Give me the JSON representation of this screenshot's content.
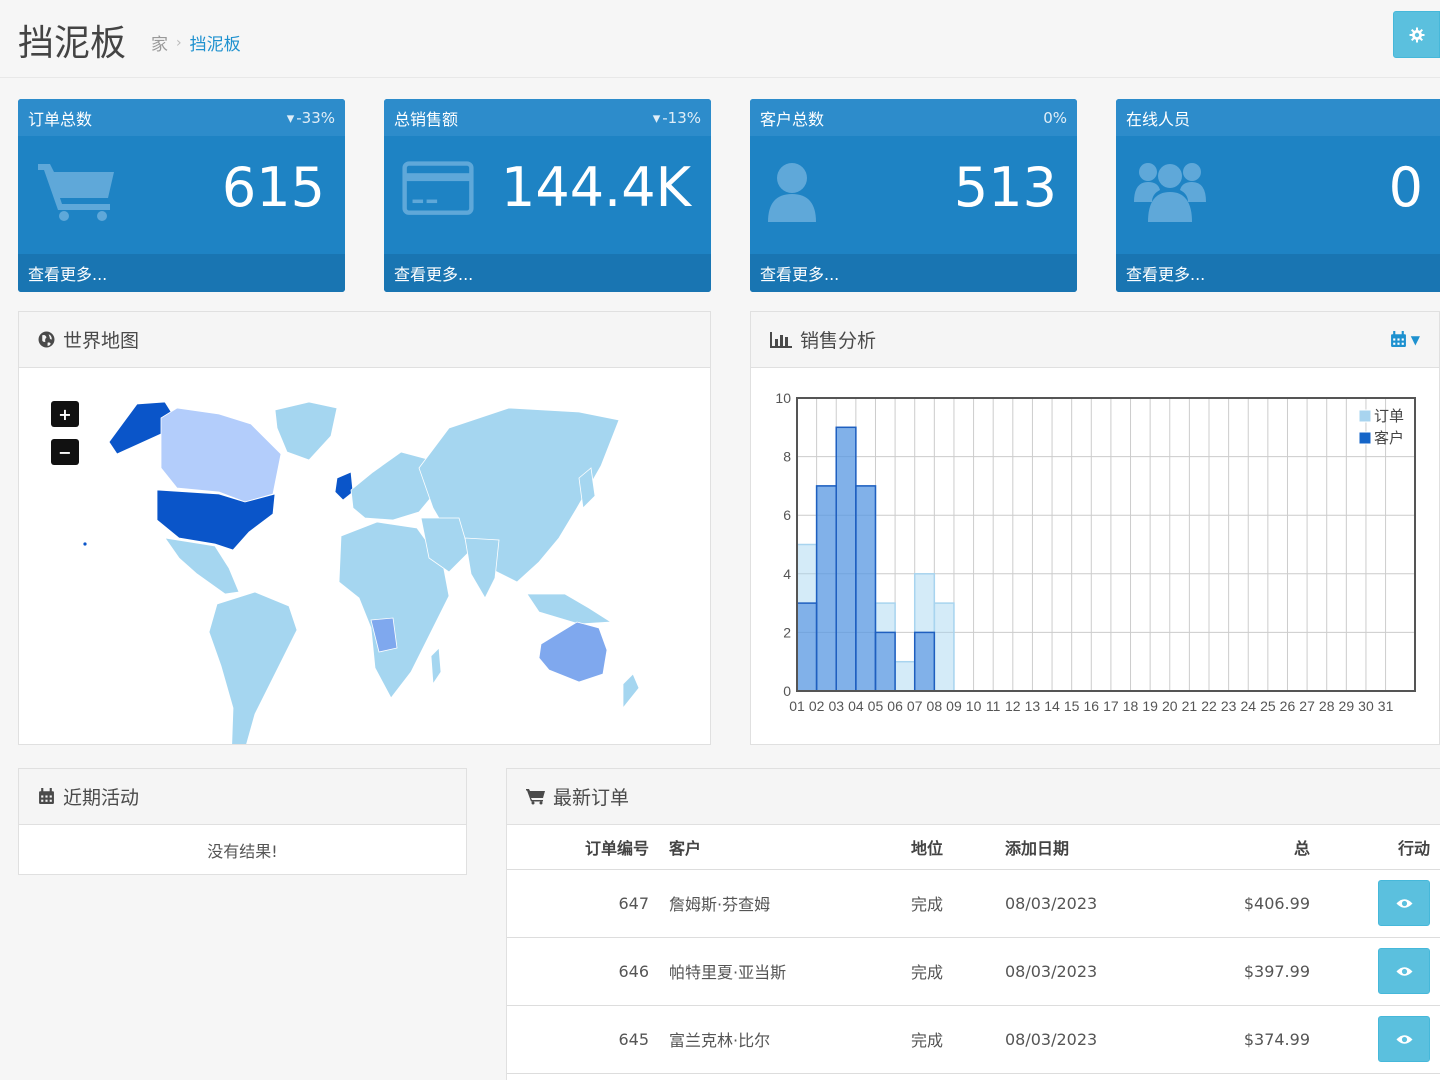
{
  "header": {
    "title": "挡泥板",
    "breadcrumb": [
      "家",
      "挡泥板"
    ]
  },
  "tiles": [
    {
      "title": "订单总数",
      "delta": "-33%",
      "value": "615",
      "more": "查看更多...",
      "icon": "shopping-cart-icon"
    },
    {
      "title": "总销售额",
      "delta": "-13%",
      "value": "144.4K",
      "more": "查看更多...",
      "icon": "credit-card-icon"
    },
    {
      "title": "客户总数",
      "delta": "0%",
      "value": "513",
      "more": "查看更多...",
      "icon": "user-icon"
    },
    {
      "title": "在线人员",
      "value": "0",
      "more": "查看更多...",
      "icon": "users-icon"
    }
  ],
  "map_panel": {
    "title": "世界地图",
    "zoom_in": "+",
    "zoom_out": "−"
  },
  "sales_panel": {
    "title": "销售分析"
  },
  "activity_panel": {
    "title": "近期活动",
    "empty": "没有结果!"
  },
  "orders_panel": {
    "title": "最新订单",
    "columns": [
      "订单编号",
      "客户",
      "地位",
      "添加日期",
      "总",
      "行动"
    ],
    "rows": [
      {
        "id": "647",
        "customer": "詹姆斯·芬查姆",
        "status": "完成",
        "date": "08/03/2023",
        "total": "$406.99"
      },
      {
        "id": "646",
        "customer": "帕特里夏·亚当斯",
        "status": "完成",
        "date": "08/03/2023",
        "total": "$397.99"
      },
      {
        "id": "645",
        "customer": "富兰克林·比尔",
        "status": "完成",
        "date": "08/03/2023",
        "total": "$374.99"
      }
    ]
  },
  "colors": {
    "tile": "#1e83c4",
    "accent": "#1e91cf",
    "info": "#5bc0de",
    "orders": "#cde9f7",
    "customers": "#1565c8"
  },
  "chart_data": {
    "type": "bar",
    "categories": [
      "01",
      "02",
      "03",
      "04",
      "05",
      "06",
      "07",
      "08",
      "09",
      "10",
      "11",
      "12",
      "13",
      "14",
      "15",
      "16",
      "17",
      "18",
      "19",
      "20",
      "21",
      "22",
      "23",
      "24",
      "25",
      "26",
      "27",
      "28",
      "29",
      "30",
      "31"
    ],
    "series": [
      {
        "name": "订单",
        "values": [
          5,
          7,
          9,
          7,
          3,
          1,
          4,
          3,
          0,
          0,
          0,
          0,
          0,
          0,
          0,
          0,
          0,
          0,
          0,
          0,
          0,
          0,
          0,
          0,
          0,
          0,
          0,
          0,
          0,
          0,
          0
        ]
      },
      {
        "name": "客户",
        "values": [
          3,
          7,
          9,
          7,
          2,
          0,
          2,
          0,
          0,
          0,
          0,
          0,
          0,
          0,
          0,
          0,
          0,
          0,
          0,
          0,
          0,
          0,
          0,
          0,
          0,
          0,
          0,
          0,
          0,
          0,
          0
        ]
      }
    ],
    "ylim": [
      0,
      10
    ],
    "yticks": [
      "0",
      "2",
      "4",
      "6",
      "8",
      "10"
    ],
    "legend": "top-right",
    "grid": true
  }
}
